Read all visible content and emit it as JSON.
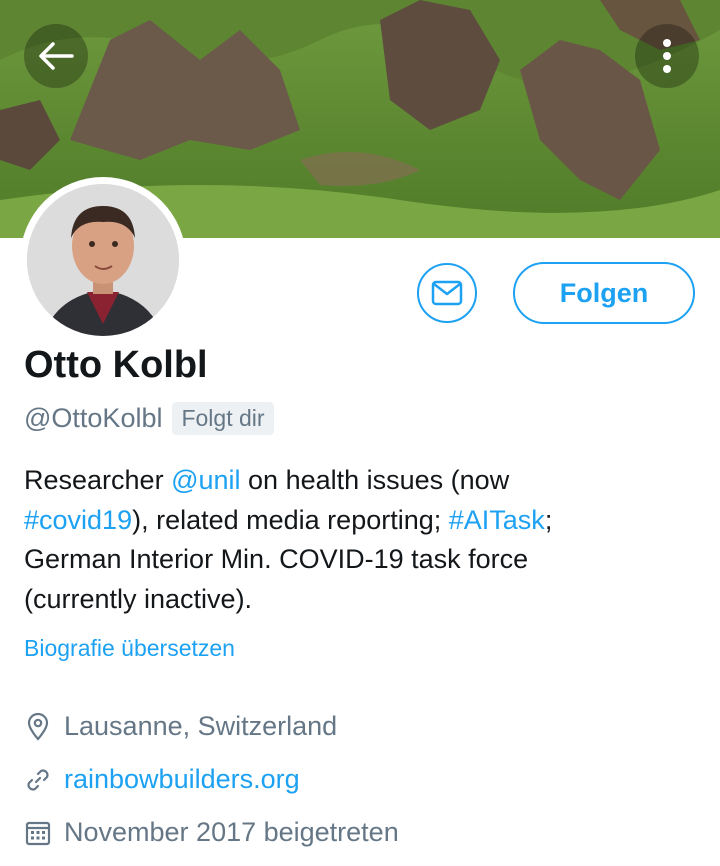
{
  "header": {
    "back_icon": "arrow-left-icon",
    "more_icon": "more-vertical-icon"
  },
  "profile": {
    "name": "Otto Kolbl",
    "handle": "@OttoKolbl",
    "follows_you_badge": "Folgt dir",
    "follow_label": "Folgen",
    "message_icon": "envelope-icon",
    "bio": {
      "line1_pre": "Researcher ",
      "line1_mention": "@unil",
      "line1_post": " on health issues (now",
      "line2_hashtag1": "#covid19",
      "line2_mid": "), related media reporting; ",
      "line2_hashtag2": "#AITask",
      "line2_post": ";",
      "line3": "German Interior Min. COVID-19 task force",
      "line4": "(currently inactive)."
    },
    "translate_label": "Biografie übersetzen",
    "location": "Lausanne, Switzerland",
    "website": "rainbowbuilders.org",
    "joined": "November 2017 beigetreten"
  },
  "colors": {
    "accent": "#1da1f2",
    "text_primary": "#14171a",
    "text_secondary": "#657786"
  }
}
